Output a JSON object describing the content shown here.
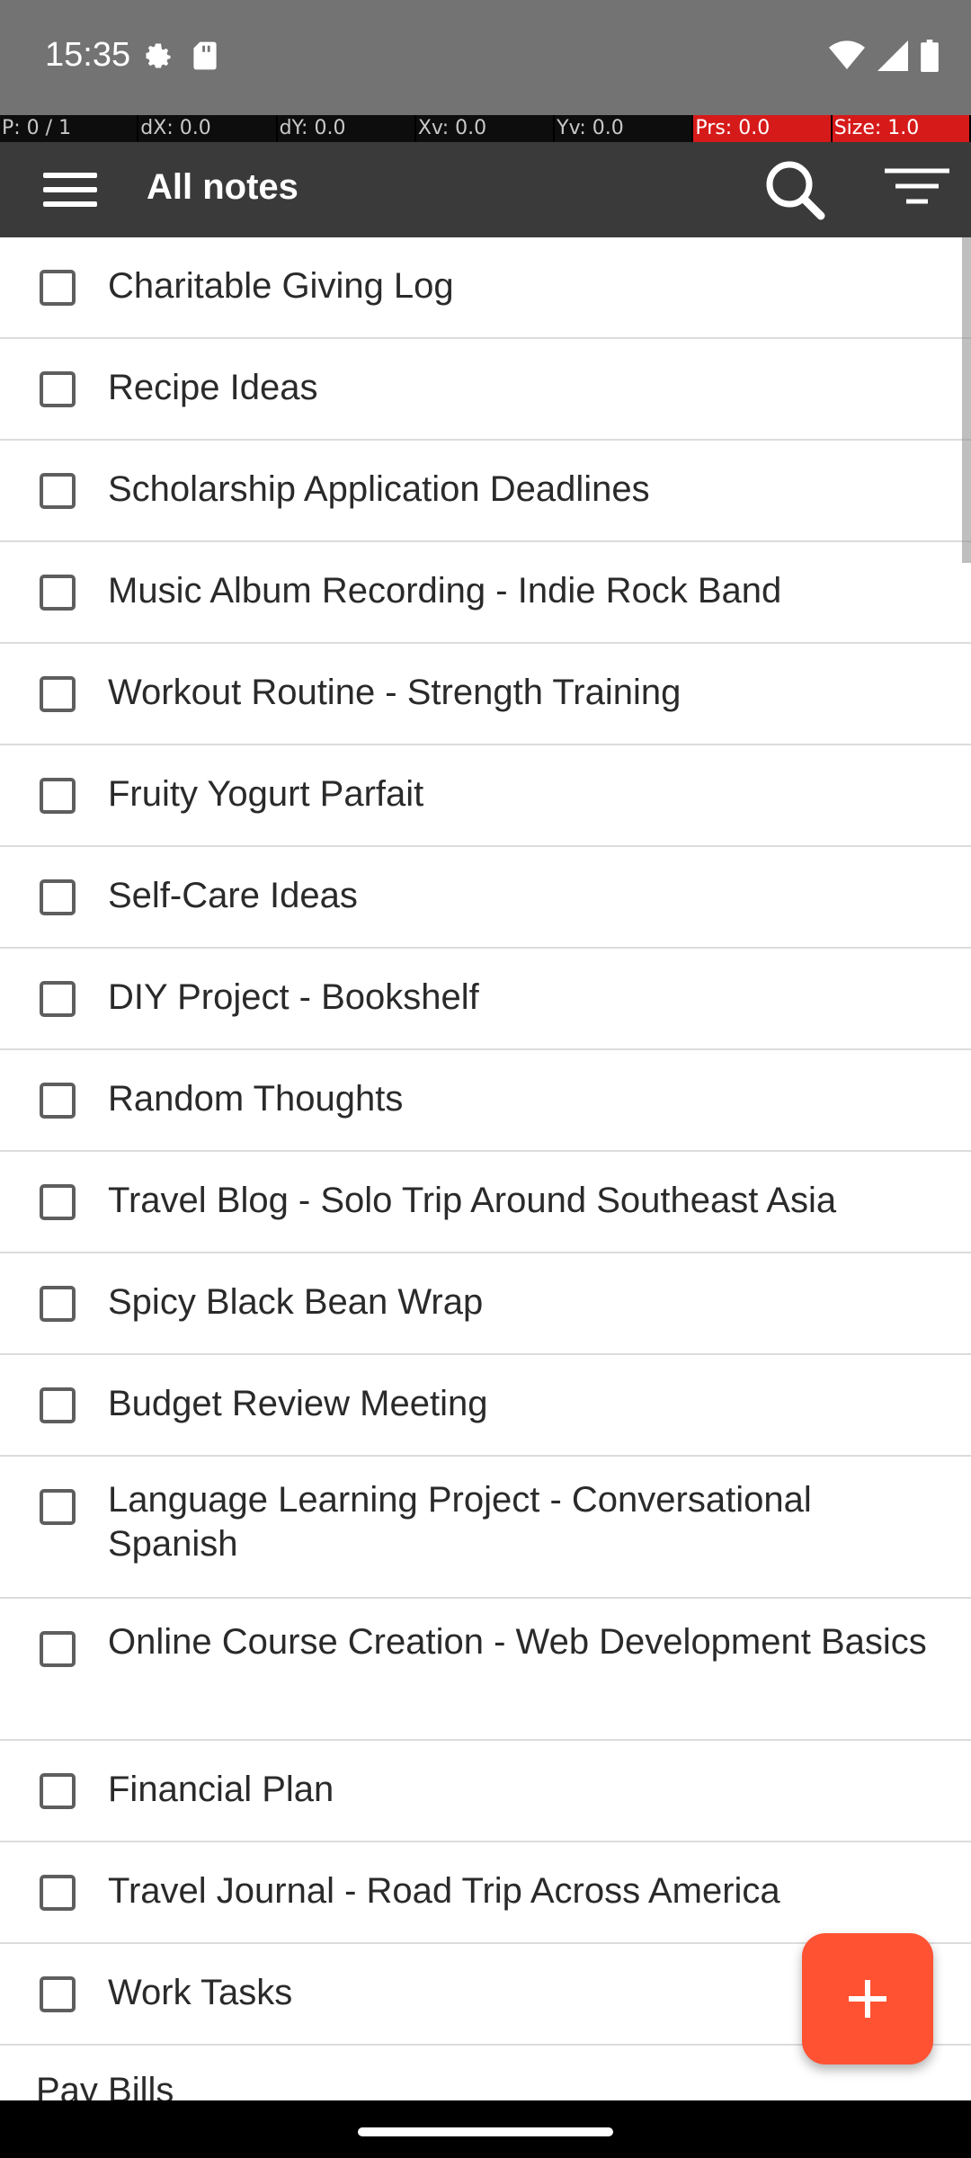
{
  "status_bar": {
    "time": "15:35",
    "left_icons": [
      "settings-icon",
      "sd-card-icon"
    ],
    "right_icons": [
      "wifi-icon",
      "signal-icon",
      "battery-icon"
    ]
  },
  "debug_overlay": {
    "cells": [
      "P: 0 / 1",
      "dX: 0.0",
      "dY: 0.0",
      "Xv: 0.0",
      "Yv: 0.0",
      "Prs: 0.0",
      "Size: 1.0"
    ]
  },
  "app_bar": {
    "title": "All notes",
    "menu_icon": "hamburger-menu-icon",
    "search_icon": "search-icon",
    "filter_icon": "filter-sort-icon"
  },
  "notes": [
    {
      "title": "Charitable Giving Log",
      "checked": false
    },
    {
      "title": "Recipe Ideas",
      "checked": false
    },
    {
      "title": "Scholarship Application Deadlines",
      "checked": false
    },
    {
      "title": "Music Album Recording - Indie Rock Band",
      "checked": false
    },
    {
      "title": "Workout Routine - Strength Training",
      "checked": false
    },
    {
      "title": "Fruity Yogurt Parfait",
      "checked": false
    },
    {
      "title": "Self-Care Ideas",
      "checked": false
    },
    {
      "title": "DIY Project - Bookshelf",
      "checked": false
    },
    {
      "title": "Random Thoughts",
      "checked": false
    },
    {
      "title": "Travel Blog - Solo Trip Around Southeast Asia",
      "checked": false
    },
    {
      "title": "Spicy Black Bean Wrap",
      "checked": false
    },
    {
      "title": "Budget Review Meeting",
      "checked": false
    },
    {
      "title": "Language Learning Project - Conversational Spanish",
      "checked": false
    },
    {
      "title": "Online Course Creation - Web Development Basics",
      "checked": false
    },
    {
      "title": "Financial Plan",
      "checked": false
    },
    {
      "title": "Travel Journal - Road Trip Across America",
      "checked": false
    },
    {
      "title": "Work Tasks",
      "checked": false
    },
    {
      "title": "Pay Bills"
    }
  ],
  "fab": {
    "icon": "plus-icon"
  },
  "colors": {
    "status_bar": "#737373",
    "app_bar": "#3a3a3a",
    "fab": "#ff5233",
    "divider": "#dcdcdc"
  }
}
